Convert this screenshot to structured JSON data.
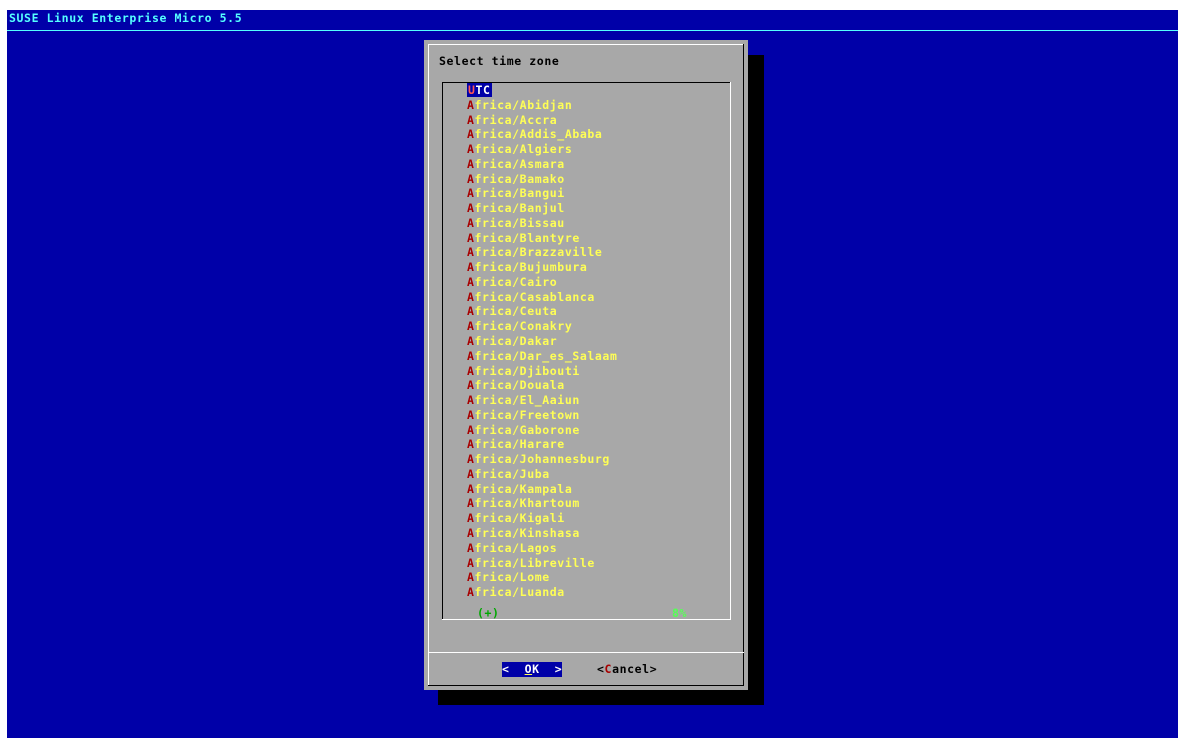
{
  "backtitle": "SUSE Linux Enterprise Micro 5.5",
  "dialog": {
    "title": "Select time zone",
    "scroll_indicator": "(+)",
    "scroll_percent": "8%",
    "items": [
      "UTC",
      "Africa/Abidjan",
      "Africa/Accra",
      "Africa/Addis_Ababa",
      "Africa/Algiers",
      "Africa/Asmara",
      "Africa/Bamako",
      "Africa/Bangui",
      "Africa/Banjul",
      "Africa/Bissau",
      "Africa/Blantyre",
      "Africa/Brazzaville",
      "Africa/Bujumbura",
      "Africa/Cairo",
      "Africa/Casablanca",
      "Africa/Ceuta",
      "Africa/Conakry",
      "Africa/Dakar",
      "Africa/Dar_es_Salaam",
      "Africa/Djibouti",
      "Africa/Douala",
      "Africa/El_Aaiun",
      "Africa/Freetown",
      "Africa/Gaborone",
      "Africa/Harare",
      "Africa/Johannesburg",
      "Africa/Juba",
      "Africa/Kampala",
      "Africa/Khartoum",
      "Africa/Kigali",
      "Africa/Kinshasa",
      "Africa/Lagos",
      "Africa/Libreville",
      "Africa/Lome",
      "Africa/Luanda"
    ],
    "selected_index": 0,
    "buttons": {
      "ok": {
        "open": "<",
        "hotkey": "O",
        "rest": "K",
        "close": ">"
      },
      "cancel": {
        "open": "<",
        "hotkey": "C",
        "rest": "ancel",
        "close": ">"
      }
    }
  },
  "colors": {
    "screen_bg": "#0000a8",
    "dialog_bg": "#a8a8a8",
    "item_text": "#ffff55",
    "hotkey": "#a80000",
    "backtitle": "#55ffff"
  }
}
